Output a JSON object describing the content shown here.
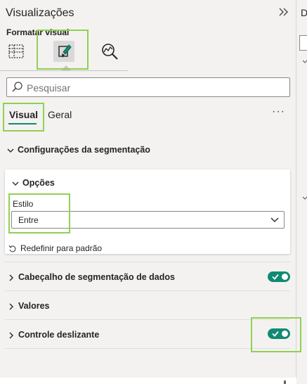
{
  "pane": {
    "title": "Visualizações",
    "subtitle": "Formatar visual",
    "tab_icons": [
      "table-build-icon",
      "paintbrush-format-icon",
      "analytics-magnifier-icon"
    ]
  },
  "search": {
    "placeholder": "Pesquisar",
    "value": ""
  },
  "subtabs": {
    "visual": "Visual",
    "geral": "Geral",
    "more": "···"
  },
  "sections": {
    "config": "Configurações da segmentação",
    "options": {
      "title": "Opções",
      "style_label": "Estilo",
      "style_value": "Entre",
      "reset": "Redefinir para padrão"
    },
    "header": {
      "label": "Cabeçalho de segmentação de dados",
      "toggle_on": true
    },
    "values": {
      "label": "Valores"
    },
    "slider": {
      "label": "Controle deslizante",
      "toggle_on": true
    }
  },
  "right_strip": {
    "letter": "D"
  },
  "colors": {
    "accent": "#118a72",
    "highlight": "#92d050",
    "pane_bg": "#f3f2f1"
  }
}
